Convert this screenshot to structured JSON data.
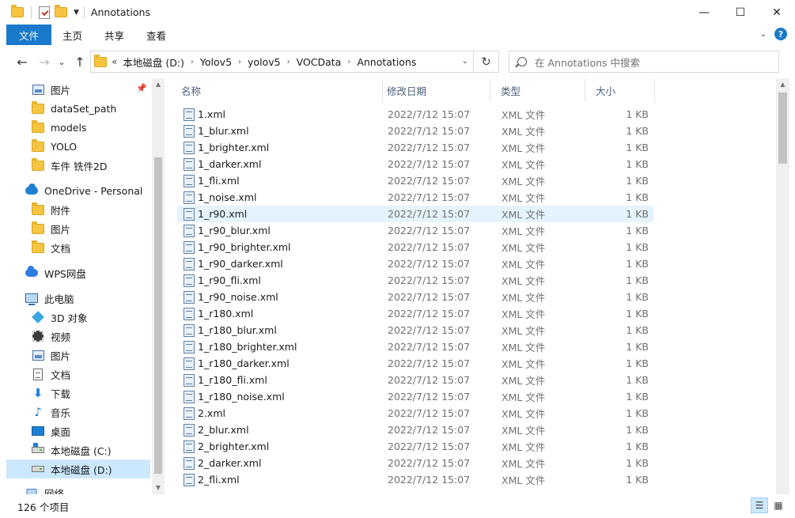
{
  "window": {
    "title": "Annotations",
    "minimize_glyph": "—",
    "maximize_glyph": "☐",
    "close_glyph": "✕"
  },
  "ribbon": {
    "file_tab": "文件",
    "tabs": [
      "主页",
      "共享",
      "查看"
    ]
  },
  "navigation": {
    "back_glyph": "←",
    "forward_glyph": "→",
    "recent_glyph": "⌄",
    "up_glyph": "↑",
    "refresh_glyph": "↻",
    "overflow_glyph": "«",
    "breadcrumbs": [
      "本地磁盘 (D:)",
      "Yolov5",
      "yolov5",
      "VOCData",
      "Annotations"
    ],
    "crumb_separator": "›"
  },
  "search": {
    "placeholder": "在 Annotations 中搜索"
  },
  "sidebar": {
    "items": [
      {
        "label": "图片",
        "icon": "pictures-icon",
        "pinned": true
      },
      {
        "label": "dataSet_path",
        "icon": "folder-icon"
      },
      {
        "label": "models",
        "icon": "folder-icon"
      },
      {
        "label": "YOLO",
        "icon": "folder-icon"
      },
      {
        "label": "车件  铣件2D",
        "icon": "folder-icon"
      },
      {
        "label": "OneDrive - Personal",
        "icon": "onedrive-icon"
      },
      {
        "label": "附件",
        "icon": "folder-icon"
      },
      {
        "label": "图片",
        "icon": "folder-icon"
      },
      {
        "label": "文档",
        "icon": "folder-icon"
      },
      {
        "label": "WPS网盘",
        "icon": "wps-cloud-icon"
      },
      {
        "label": "此电脑",
        "icon": "this-pc-icon"
      },
      {
        "label": "3D 对象",
        "icon": "3d-objects-icon"
      },
      {
        "label": "视频",
        "icon": "videos-icon"
      },
      {
        "label": "图片",
        "icon": "pictures-icon"
      },
      {
        "label": "文档",
        "icon": "documents-icon"
      },
      {
        "label": "下载",
        "icon": "downloads-icon"
      },
      {
        "label": "音乐",
        "icon": "music-icon"
      },
      {
        "label": "桌面",
        "icon": "desktop-icon"
      },
      {
        "label": "本地磁盘 (C:)",
        "icon": "drive-c-icon"
      },
      {
        "label": "本地磁盘 (D:)",
        "icon": "drive-d-icon",
        "selected": true
      },
      {
        "label": "网络",
        "icon": "network-icon"
      }
    ]
  },
  "columns": {
    "name": "名称",
    "date": "修改日期",
    "type": "类型",
    "size": "大小"
  },
  "files": [
    {
      "name": "1.xml",
      "date": "2022/7/12 15:07",
      "type": "XML 文件",
      "size": "1 KB"
    },
    {
      "name": "1_blur.xml",
      "date": "2022/7/12 15:07",
      "type": "XML 文件",
      "size": "1 KB"
    },
    {
      "name": "1_brighter.xml",
      "date": "2022/7/12 15:07",
      "type": "XML 文件",
      "size": "1 KB"
    },
    {
      "name": "1_darker.xml",
      "date": "2022/7/12 15:07",
      "type": "XML 文件",
      "size": "1 KB"
    },
    {
      "name": "1_fli.xml",
      "date": "2022/7/12 15:07",
      "type": "XML 文件",
      "size": "1 KB"
    },
    {
      "name": "1_noise.xml",
      "date": "2022/7/12 15:07",
      "type": "XML 文件",
      "size": "1 KB"
    },
    {
      "name": "1_r90.xml",
      "date": "2022/7/12 15:07",
      "type": "XML 文件",
      "size": "1 KB",
      "hover": true
    },
    {
      "name": "1_r90_blur.xml",
      "date": "2022/7/12 15:07",
      "type": "XML 文件",
      "size": "1 KB"
    },
    {
      "name": "1_r90_brighter.xml",
      "date": "2022/7/12 15:07",
      "type": "XML 文件",
      "size": "1 KB"
    },
    {
      "name": "1_r90_darker.xml",
      "date": "2022/7/12 15:07",
      "type": "XML 文件",
      "size": "1 KB"
    },
    {
      "name": "1_r90_fli.xml",
      "date": "2022/7/12 15:07",
      "type": "XML 文件",
      "size": "1 KB"
    },
    {
      "name": "1_r90_noise.xml",
      "date": "2022/7/12 15:07",
      "type": "XML 文件",
      "size": "1 KB"
    },
    {
      "name": "1_r180.xml",
      "date": "2022/7/12 15:07",
      "type": "XML 文件",
      "size": "1 KB"
    },
    {
      "name": "1_r180_blur.xml",
      "date": "2022/7/12 15:07",
      "type": "XML 文件",
      "size": "1 KB"
    },
    {
      "name": "1_r180_brighter.xml",
      "date": "2022/7/12 15:07",
      "type": "XML 文件",
      "size": "1 KB"
    },
    {
      "name": "1_r180_darker.xml",
      "date": "2022/7/12 15:07",
      "type": "XML 文件",
      "size": "1 KB"
    },
    {
      "name": "1_r180_fli.xml",
      "date": "2022/7/12 15:07",
      "type": "XML 文件",
      "size": "1 KB"
    },
    {
      "name": "1_r180_noise.xml",
      "date": "2022/7/12 15:07",
      "type": "XML 文件",
      "size": "1 KB"
    },
    {
      "name": "2.xml",
      "date": "2022/7/12 15:07",
      "type": "XML 文件",
      "size": "1 KB"
    },
    {
      "name": "2_blur.xml",
      "date": "2022/7/12 15:07",
      "type": "XML 文件",
      "size": "1 KB"
    },
    {
      "name": "2_brighter.xml",
      "date": "2022/7/12 15:07",
      "type": "XML 文件",
      "size": "1 KB"
    },
    {
      "name": "2_darker.xml",
      "date": "2022/7/12 15:07",
      "type": "XML 文件",
      "size": "1 KB"
    },
    {
      "name": "2_fli.xml",
      "date": "2022/7/12 15:07",
      "type": "XML 文件",
      "size": "1 KB"
    }
  ],
  "status": {
    "count": "126 个项目"
  },
  "colors": {
    "accent": "#1979ca",
    "selection": "#cce8ff",
    "hover": "#e5f3ff",
    "header_text": "#4c607a",
    "secondary_text": "#707070"
  }
}
